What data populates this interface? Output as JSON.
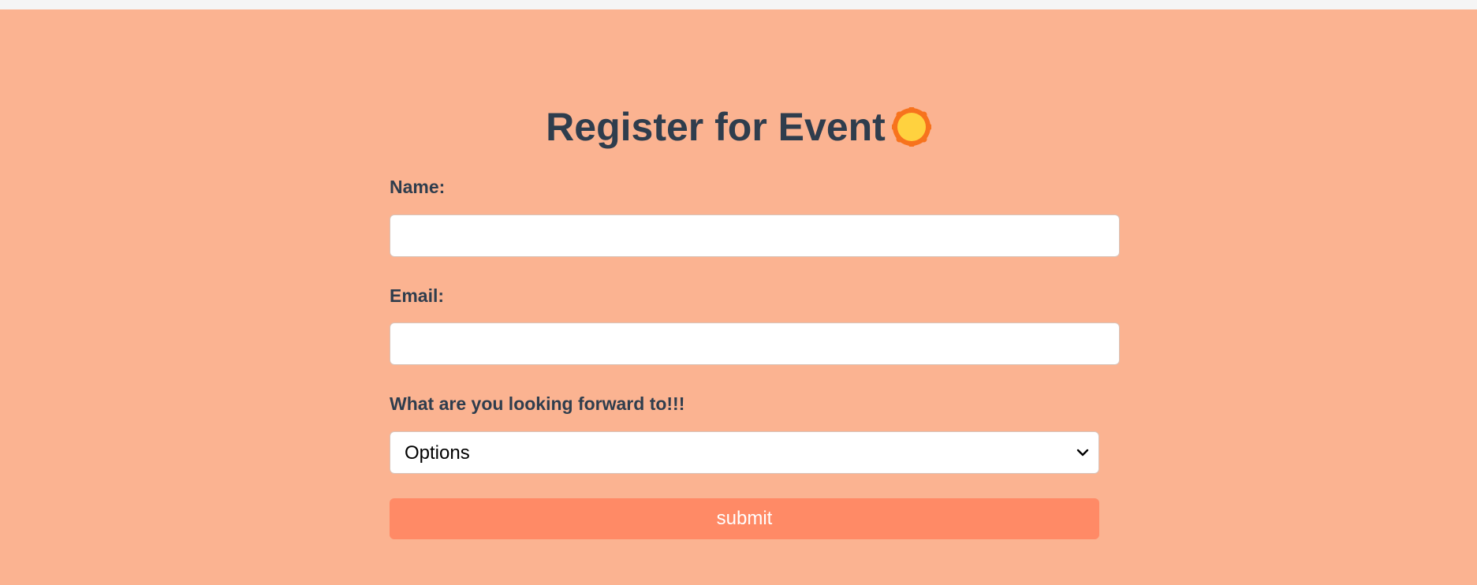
{
  "form": {
    "title": "Register for Event",
    "title_icon": "sun-icon",
    "name_label": "Name:",
    "name_value": "",
    "email_label": "Email:",
    "email_value": "",
    "interest_label": "What are you looking forward to!!!",
    "interest_selected": "Options",
    "submit_label": "submit"
  },
  "colors": {
    "background": "#fbb391",
    "title_text": "#2f3d4d",
    "submit_button": "#ff8a66",
    "sun_fill": "#ffd23f",
    "sun_rays": "#f7731d"
  }
}
